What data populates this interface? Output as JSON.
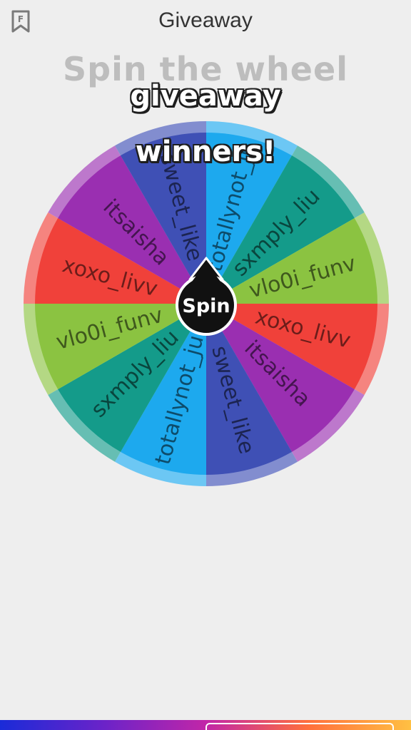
{
  "header": {
    "title": "Giveaway",
    "bookmark_letter": "F",
    "bookmark_icon": "bookmark-icon"
  },
  "main": {
    "title": "Spin the wheel"
  },
  "overlay": {
    "line1": "giveaway",
    "line2": "winners!"
  },
  "wheel": {
    "spin_label": "Spin",
    "segments": [
      {
        "label": "totallynot_ju",
        "color": "#1da9ee"
      },
      {
        "label": "sxmply_liu",
        "color": "#149b8a"
      },
      {
        "label": "vlo0i_funv",
        "color": "#8bc341"
      },
      {
        "label": "xoxo_livv",
        "color": "#f0413a"
      },
      {
        "label": "itsaisha",
        "color": "#9a2fb1"
      },
      {
        "label": "sweet_like",
        "color": "#3f50b5"
      },
      {
        "label": "totallynot_ju",
        "color": "#1da9ee"
      },
      {
        "label": "sxmply_liu",
        "color": "#149b8a"
      },
      {
        "label": "vlo0i_funv",
        "color": "#8bc341"
      },
      {
        "label": "xoxo_livv",
        "color": "#f0413a"
      },
      {
        "label": "itsaisha",
        "color": "#9a2fb1"
      },
      {
        "label": "sweet_like",
        "color": "#3f50b5"
      }
    ]
  }
}
